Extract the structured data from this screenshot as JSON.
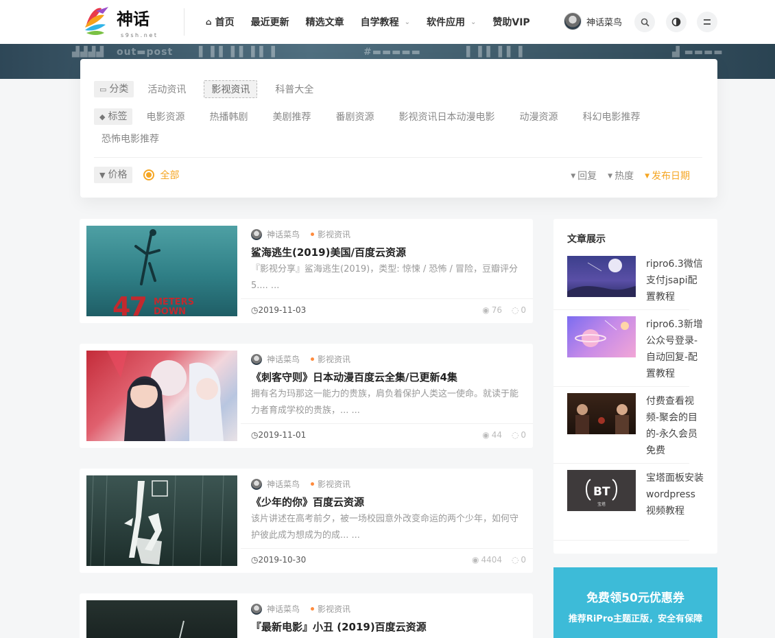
{
  "header": {
    "nav": [
      {
        "label": "首页",
        "icon": "home-icon",
        "dropdown": false
      },
      {
        "label": "最近更新",
        "dropdown": false
      },
      {
        "label": "精选文章",
        "dropdown": false
      },
      {
        "label": "自学教程",
        "dropdown": true
      },
      {
        "label": "软件应用",
        "dropdown": true
      },
      {
        "label": "赞助VIP",
        "dropdown": false
      }
    ],
    "user_name": "神话菜鸟"
  },
  "filter": {
    "category_label": "分类",
    "categories": [
      "活动资讯",
      "影视资讯",
      "科普大全"
    ],
    "active_category": "影视资讯",
    "tag_label": "标签",
    "tags": [
      "电影资源",
      "热播韩剧",
      "美剧推荐",
      "番剧资源",
      "影视资讯日本动漫电影",
      "动漫资源",
      "科幻电影推荐",
      "恐怖电影推荐"
    ],
    "price_label": "价格",
    "price_all": "全部",
    "sorts": [
      "回复",
      "热度",
      "发布日期"
    ],
    "active_sort": "发布日期"
  },
  "articles": [
    {
      "author": "神话菜鸟",
      "category": "影视资讯",
      "title": "鲨海逃生(2019)美国/百度云资源",
      "excerpt": "『影视分享』鲨海逃生(2019)，类型: 惊悚 / 恐怖 / 冒险，豆瓣评分5.... ...",
      "date": "2019-11-03",
      "views": "76",
      "comments": "0",
      "thumb_text": [
        "47",
        "METERS",
        "DOWN"
      ]
    },
    {
      "author": "神话菜鸟",
      "category": "影视资讯",
      "title": "《刺客守则》日本动漫百度云全集/已更新4集",
      "excerpt": "拥有名为玛那这一能力的贵族，肩负着保护人类这一使命。就读于能力者育成学校的贵族，... ...",
      "date": "2019-11-01",
      "views": "44",
      "comments": "0"
    },
    {
      "author": "神话菜鸟",
      "category": "影视资讯",
      "title": "《少年的你》百度云资源",
      "excerpt": "该片讲述在高考前夕，被一场校园意外改变命运的两个少年，如何守护彼此成为想成为的成... ...",
      "date": "2019-10-30",
      "views": "4404",
      "comments": "0"
    },
    {
      "author": "神话菜鸟",
      "category": "影视资讯",
      "title": "『最新电影』小丑 (2019)百度云资源"
    }
  ],
  "sidebar": {
    "title": "文章展示",
    "items": [
      {
        "title": "ripro6.3微信支付jsapi配置教程"
      },
      {
        "title": "ripro6.3新增公众号登录-自动回复-配置教程"
      },
      {
        "title": "付费查看视频-聚会的目的-永久会员免费"
      },
      {
        "title": "宝塔面板安装wordpress视频教程",
        "logo_text": "宝塔"
      }
    ]
  },
  "promo": {
    "title": "免费领50元优惠券",
    "subtitle": "推荐RiPro主题正版，安全有保障"
  },
  "colors": {
    "accent": "#f5a623",
    "promo": "#3dbbd8",
    "category_dot": "#ff8b3d"
  }
}
